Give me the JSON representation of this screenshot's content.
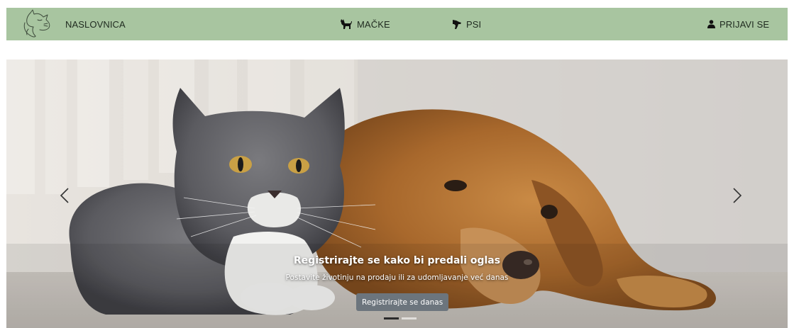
{
  "navbar": {
    "logo_icon": "cat-dog-logo-icon",
    "home_label": "NASLOVNICA",
    "cats_label": "MAČKE",
    "cats_icon": "cat-icon",
    "dogs_label": "PSI",
    "dogs_icon": "dog-icon",
    "login_label": "PRIJAVI SE",
    "login_icon": "user-icon",
    "background_color": "#a8c5a0"
  },
  "carousel": {
    "slide_title": "Registrirajte se kako bi predali oglas",
    "slide_subtitle": "Postavite životinju na prodaju ili za udomljavanje već danas",
    "cta_label": "Registrirajte se danas",
    "prev_icon": "chevron-left-icon",
    "next_icon": "chevron-right-icon",
    "slide_count": 2,
    "active_slide": 1,
    "hero_image": "gray-cat-and-golden-retriever-photo"
  }
}
